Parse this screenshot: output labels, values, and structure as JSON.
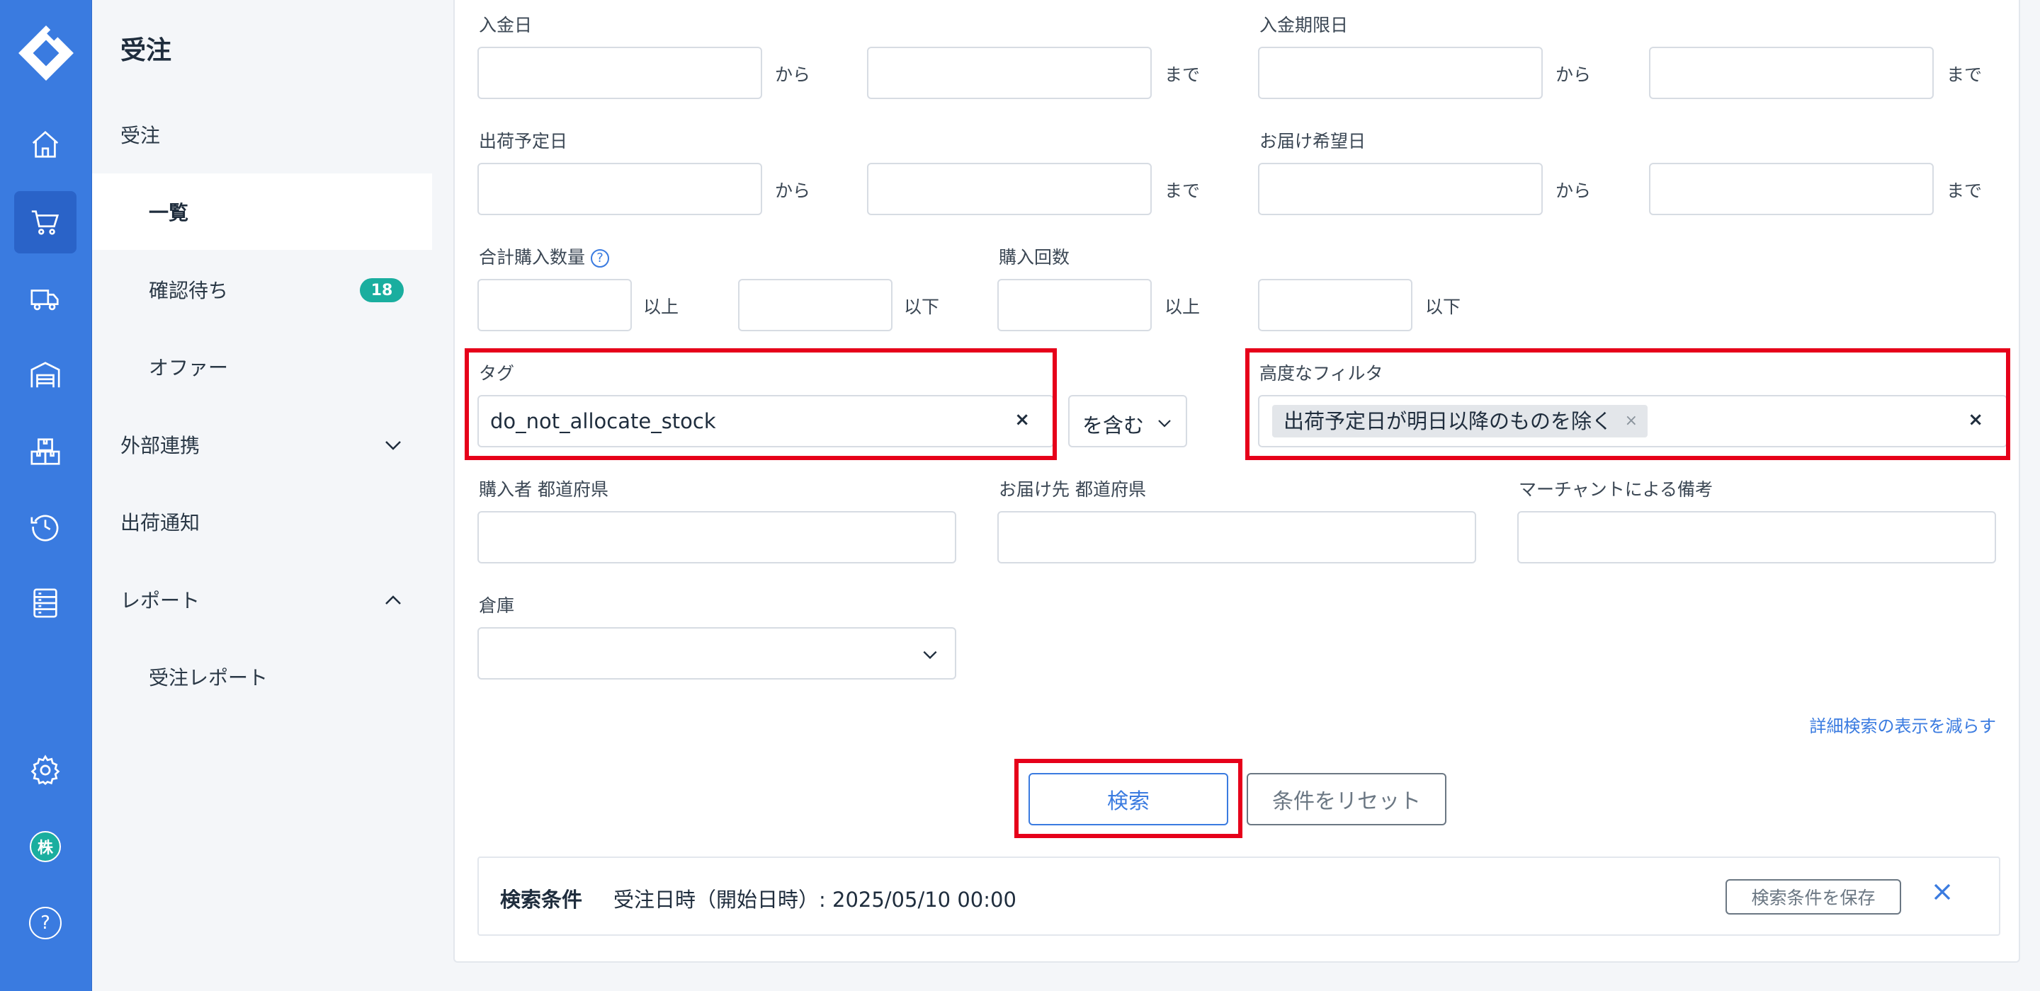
{
  "colors": {
    "accent": "#3a7be0",
    "badge": "#1aae9f",
    "highlight": "#e6001a"
  },
  "rail": {
    "items": [
      {
        "icon": "home-icon"
      },
      {
        "icon": "cart-icon"
      },
      {
        "icon": "truck-icon"
      },
      {
        "icon": "warehouse-icon"
      },
      {
        "icon": "boxes-icon"
      },
      {
        "icon": "history-icon"
      },
      {
        "icon": "list-icon"
      },
      {
        "icon": "gear-icon"
      },
      {
        "icon": "company-icon",
        "label": "株"
      },
      {
        "icon": "help-icon",
        "label": "?"
      }
    ]
  },
  "menu": {
    "title": "受注",
    "items": [
      {
        "label": "受注"
      },
      {
        "label": "一覧"
      },
      {
        "label": "確認待ち",
        "badge": "18"
      },
      {
        "label": "オファー"
      },
      {
        "label": "外部連携"
      },
      {
        "label": "出荷通知"
      },
      {
        "label": "レポート"
      },
      {
        "label": "受注レポート"
      }
    ]
  },
  "form": {
    "payment_date": "入金日",
    "payment_deadline": "入金期限日",
    "ship_scheduled": "出荷予定日",
    "delivery_requested": "お届け希望日",
    "from": "から",
    "until": "まで",
    "total_qty": "合計購入数量",
    "help_mark": "?",
    "purchase_count": "購入回数",
    "min": "以上",
    "max": "以下",
    "tag_label": "タグ",
    "tag_value": "do_not_allocate_stock",
    "tag_mode": "を含む",
    "adv_filter_label": "高度なフィルタ",
    "adv_filter_chip": "出荷予定日が明日以降のものを除く",
    "clear_mark": "×",
    "buyer_pref": "購入者 都道府県",
    "dest_pref": "お届け先 都道府県",
    "merchant_note": "マーチャントによる備考",
    "warehouse": "倉庫",
    "less_detail": "詳細検索の表示を減らす",
    "search_btn": "検索",
    "reset_btn": "条件をリセット"
  },
  "conditions": {
    "title": "検索条件",
    "text": "受注日時（開始日時）: 2025/05/10 00:00",
    "save_btn": "検索条件を保存"
  }
}
